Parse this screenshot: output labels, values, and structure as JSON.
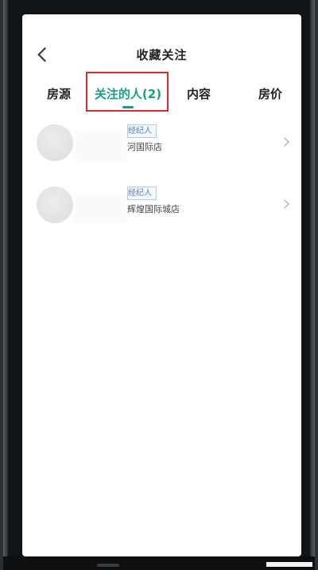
{
  "header": {
    "title": "收藏关注",
    "back_icon": "chevron-left-icon"
  },
  "tabs": [
    {
      "label": "房源",
      "active": false
    },
    {
      "label": "关注的人(2)",
      "active": true
    },
    {
      "label": "内容",
      "active": false
    },
    {
      "label": "房价",
      "active": false
    }
  ],
  "colors": {
    "accent": "#16a085",
    "highlight_box": "#d9272e",
    "badge_text": "#5b7fb3"
  },
  "agents": [
    {
      "role": "经纪人",
      "role_visible": "经纪人",
      "store": "北河国际店",
      "store_visible": "河国际店"
    },
    {
      "role": "经纪人",
      "role_visible": "经纪人",
      "store": "辉煌国际城店",
      "store_visible": "辉煌国际城店"
    }
  ]
}
